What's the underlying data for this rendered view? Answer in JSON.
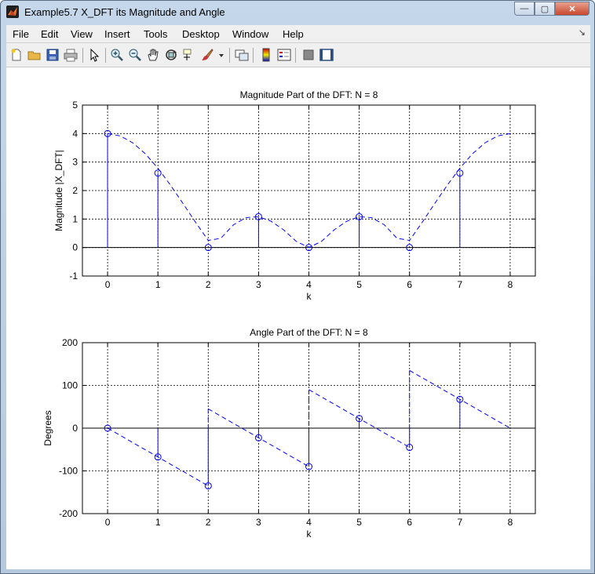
{
  "window": {
    "title": "Example5.7 X_DFT its Magnitude and Angle",
    "controls": {
      "minimize": "—",
      "maximize": "▢",
      "close": "✕"
    }
  },
  "menu": {
    "items": [
      "File",
      "Edit",
      "View",
      "Insert",
      "Tools",
      "Desktop",
      "Window",
      "Help"
    ],
    "overflow": "↘"
  },
  "toolbar": {
    "icons": [
      "new-figure-icon",
      "open-file-icon",
      "save-icon",
      "print-icon",
      "pointer-icon",
      "zoom-in-icon",
      "zoom-out-icon",
      "pan-hand-icon",
      "rotate-3d-icon",
      "data-cursor-icon",
      "brush-icon",
      "brush-dropdown-icon",
      "link-plot-icon",
      "colorbar-icon",
      "legend-icon",
      "hide-plot-tools-icon",
      "show-plot-tools-icon"
    ]
  },
  "chart_data": [
    {
      "type": "stem",
      "title": "Magnitude Part of the DFT: N = 8",
      "xlabel": "k",
      "ylabel": "Magnitude  |X_DFT|",
      "xlim": [
        -0.5,
        8.5
      ],
      "ylim": [
        -1,
        5
      ],
      "xticks": [
        0,
        1,
        2,
        3,
        4,
        5,
        6,
        7,
        8
      ],
      "yticks": [
        -1,
        0,
        1,
        2,
        3,
        4,
        5
      ],
      "grid": true,
      "stem": {
        "x": [
          0,
          1,
          2,
          3,
          4,
          5,
          6,
          7
        ],
        "y": [
          4,
          2.613,
          0,
          1.082,
          0,
          1.082,
          0,
          2.613
        ]
      },
      "curve": {
        "style": "dashed",
        "x": [
          0,
          0.25,
          0.5,
          0.75,
          1,
          1.25,
          1.5,
          1.75,
          2,
          2.25,
          2.5,
          2.75,
          3,
          3.25,
          3.5,
          3.75,
          4,
          4.25,
          4.5,
          4.75,
          5,
          5.25,
          5.5,
          5.75,
          6,
          6.25,
          6.5,
          6.75,
          7,
          7.25,
          7.5,
          7.75,
          8
        ],
        "y": [
          4,
          3.917,
          3.676,
          3.29,
          2.784,
          2.189,
          1.542,
          0.882,
          0.25,
          0.325,
          0.796,
          1.049,
          1.082,
          0.922,
          0.618,
          0.215,
          0,
          0.215,
          0.618,
          0.922,
          1.082,
          1.049,
          0.796,
          0.325,
          0.25,
          0.882,
          1.542,
          2.189,
          2.784,
          3.29,
          3.676,
          3.917,
          4
        ]
      }
    },
    {
      "type": "stem",
      "title": "Angle Part of the DFT: N = 8",
      "xlabel": "k",
      "ylabel": "Degrees",
      "xlim": [
        -0.5,
        8.5
      ],
      "ylim": [
        -200,
        200
      ],
      "xticks": [
        0,
        1,
        2,
        3,
        4,
        5,
        6,
        7,
        8
      ],
      "yticks": [
        -200,
        -100,
        0,
        100,
        200
      ],
      "grid": true,
      "stem": {
        "x": [
          0,
          1,
          2,
          3,
          4,
          5,
          6,
          7
        ],
        "y": [
          0,
          -67.5,
          -135,
          -22.5,
          -90,
          22.5,
          -45,
          67.5
        ]
      },
      "curve_segments": [
        {
          "x": [
            0,
            2
          ],
          "y": [
            0,
            -135
          ]
        },
        {
          "x": [
            2,
            4
          ],
          "y": [
            45,
            -90
          ]
        },
        {
          "x": [
            4,
            6
          ],
          "y": [
            90,
            -45
          ]
        },
        {
          "x": [
            6,
            8
          ],
          "y": [
            135,
            0
          ]
        }
      ]
    }
  ]
}
